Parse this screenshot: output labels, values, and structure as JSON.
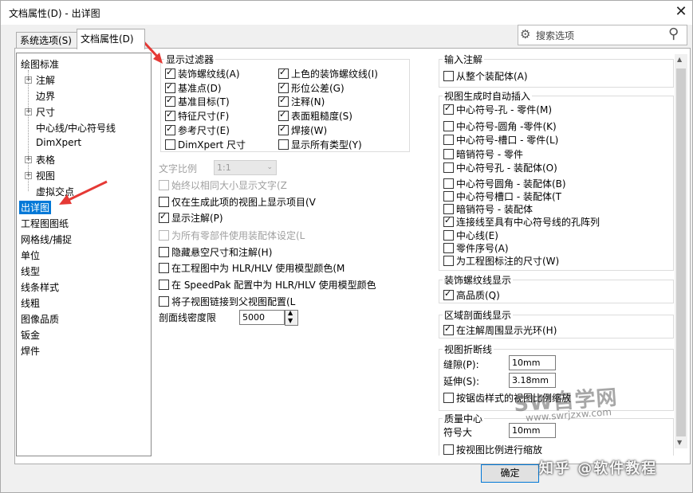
{
  "window": {
    "title": "文档属性(D) - 出详图",
    "close_glyph": "✕"
  },
  "tabs": [
    {
      "label": "系统选项(S)"
    },
    {
      "label": "文档属性(D)"
    }
  ],
  "search": {
    "placeholder": "搜索选项"
  },
  "tree": {
    "items": [
      "绘图标准",
      "注解",
      "边界",
      "尺寸",
      "中心线/中心符号线",
      "DimXpert",
      "表格",
      "视图",
      "虚拟交点",
      "出详图",
      "工程图图纸",
      "网格线/捕捉",
      "单位",
      "线型",
      "线条样式",
      "线粗",
      "图像品质",
      "钣金",
      "焊件"
    ],
    "selected": "出详图"
  },
  "display_filter": {
    "title": "显示过滤器",
    "left": [
      {
        "label": "装饰螺纹线(A)",
        "checked": true
      },
      {
        "label": "基准点(D)",
        "checked": true
      },
      {
        "label": "基准目标(T)",
        "checked": true
      },
      {
        "label": "特征尺寸(F)",
        "checked": true
      },
      {
        "label": "参考尺寸(E)",
        "checked": true
      },
      {
        "label": "DimXpert 尺寸",
        "checked": false
      }
    ],
    "right": [
      {
        "label": "上色的装饰螺纹线(I)",
        "checked": true
      },
      {
        "label": "形位公差(G)",
        "checked": true
      },
      {
        "label": "注释(N)",
        "checked": true
      },
      {
        "label": "表面粗糙度(S)",
        "checked": true
      },
      {
        "label": "焊接(W)",
        "checked": true
      },
      {
        "label": "显示所有类型(Y)",
        "checked": false
      }
    ]
  },
  "mid_options": {
    "text_scale_label": "文字比例",
    "text_scale_value": "1:1",
    "same_size_label": "始终以相同大小显示文字(Z",
    "only_in_view_label": "仅在生成此项的视图上显示项目(V",
    "show_annotations_label": "显示注解(P)",
    "assembly_settings_label": "为所有零部件使用装配体设定(L",
    "hide_dangling_label": "隐藏悬空尺寸和注解(H)",
    "hlr_drawing_label": "在工程图中为 HLR/HLV 使用模型颜色(M",
    "hlr_speedpak_label": "在 SpeedPak 配置中为 HLR/HLV 使用模型颜色",
    "link_child_label": "将子视图链接到父视图配置(L",
    "hatch_density_label": "剖面线密度限",
    "hatch_density_value": "5000"
  },
  "right_panel": {
    "input_annotations": {
      "title": "输入注解",
      "items": [
        {
          "label": "从整个装配体(A)",
          "checked": false
        }
      ]
    },
    "auto_insert": {
      "title": "视图生成时自动插入",
      "items": [
        {
          "label": "中心符号-孔 - 零件(M)",
          "checked": true
        },
        {
          "label": "中心符号-圆角 -零件(K)",
          "checked": false
        },
        {
          "label": "中心符号-槽口 - 零件(L)",
          "checked": false
        },
        {
          "label": "暗销符号 - 零件",
          "checked": false
        },
        {
          "label": "中心符号孔 - 装配体(O)",
          "checked": false
        },
        {
          "label": "中心符号圆角 - 装配体(B)",
          "checked": false
        },
        {
          "label": "中心符号槽口 - 装配体(T",
          "checked": false
        },
        {
          "label": "暗销符号 - 装配体",
          "checked": false
        },
        {
          "label": "连接线至具有中心符号线的孔阵列",
          "checked": true
        },
        {
          "label": "中心线(E)",
          "checked": false
        },
        {
          "label": "零件序号(A)",
          "checked": false
        },
        {
          "label": "为工程图标注的尺寸(W)",
          "checked": false
        }
      ]
    },
    "cosmetic_thread": {
      "title": "装饰螺纹线显示",
      "items": [
        {
          "label": "高品质(Q)",
          "checked": true
        }
      ]
    },
    "area_hatch": {
      "title": "区域剖面线显示",
      "items": [
        {
          "label": "在注解周围显示光环(H)",
          "checked": true
        }
      ]
    },
    "break_lines": {
      "title": "视图折断线",
      "gap_label": "缝隙(P):",
      "gap_value": "10mm",
      "extension_label": "延伸(S):",
      "extension_value": "3.18mm",
      "jagged_label": "按锯齿样式的视图比例缩放"
    },
    "mass_center": {
      "title": "质量中心",
      "symbol_size_label": "符号大",
      "symbol_size_value": "10mm",
      "scale_label": "按视图比例进行缩放"
    }
  },
  "buttons": {
    "ok": "确定"
  },
  "watermark": {
    "brand": "SW自学网",
    "url": "www.swrjzxw.com",
    "bottom": "知乎 @软件教程"
  },
  "colors": {
    "selection": "#0078d7",
    "arrow": "#e53935"
  }
}
